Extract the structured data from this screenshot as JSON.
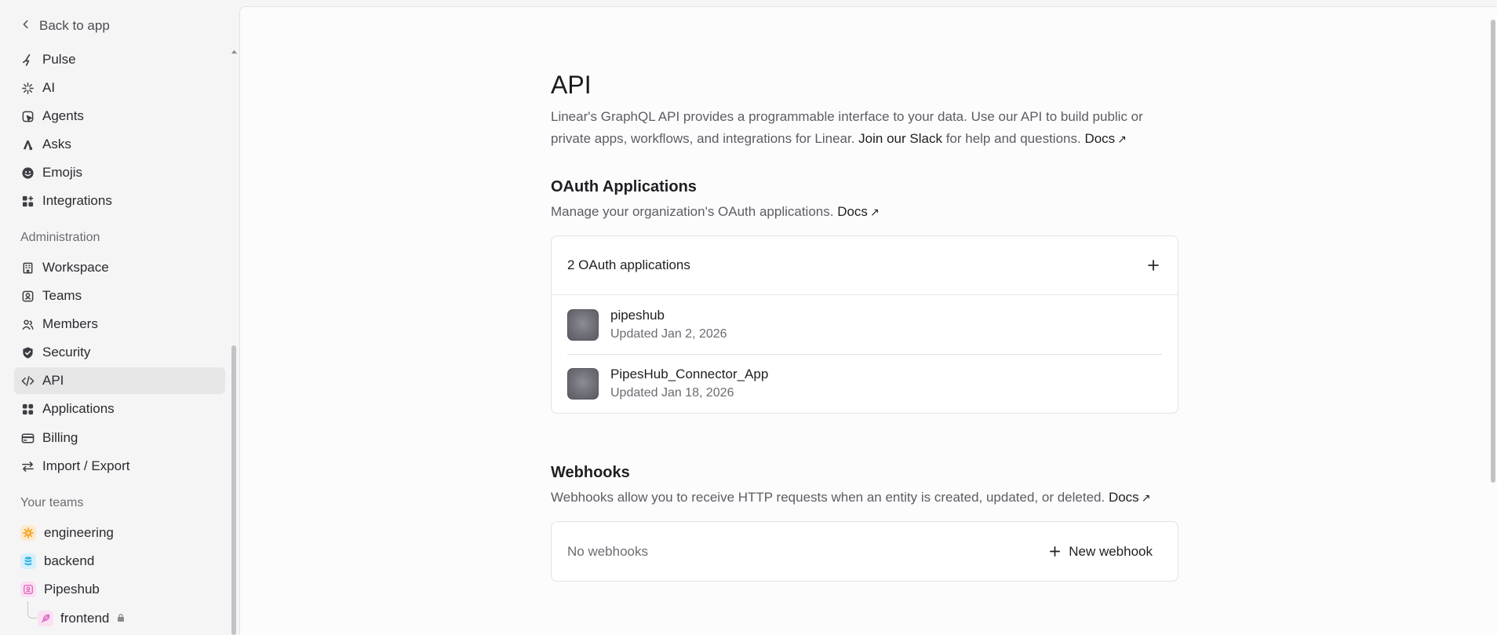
{
  "sidebar": {
    "back_label": "Back to app",
    "items_top": [
      {
        "label": "Pulse",
        "icon": "pulse-icon"
      },
      {
        "label": "AI",
        "icon": "sparkle-icon"
      },
      {
        "label": "Agents",
        "icon": "agents-icon"
      },
      {
        "label": "Asks",
        "icon": "asks-icon"
      },
      {
        "label": "Emojis",
        "icon": "emoji-icon"
      },
      {
        "label": "Integrations",
        "icon": "integrations-icon"
      }
    ],
    "admin_label": "Administration",
    "items_admin": [
      {
        "label": "Workspace",
        "icon": "building-icon"
      },
      {
        "label": "Teams",
        "icon": "teams-icon"
      },
      {
        "label": "Members",
        "icon": "members-icon"
      },
      {
        "label": "Security",
        "icon": "shield-icon"
      },
      {
        "label": "API",
        "icon": "code-icon",
        "active": true
      },
      {
        "label": "Applications",
        "icon": "applications-icon"
      },
      {
        "label": "Billing",
        "icon": "card-icon"
      },
      {
        "label": "Import / Export",
        "icon": "arrows-icon"
      }
    ],
    "teams_label": "Your teams",
    "teams": [
      {
        "label": "engineering",
        "icon": "gear-icon",
        "color": "#f5a524"
      },
      {
        "label": "backend",
        "icon": "database-icon",
        "color": "#2fb3e6"
      },
      {
        "label": "Pipeshub",
        "icon": "team-icon",
        "color": "#e05fbf"
      }
    ],
    "sub_team": {
      "label": "frontend",
      "icon": "feather-icon",
      "color": "#e05fbf"
    }
  },
  "main": {
    "title": "API",
    "desc_part1": "Linear's GraphQL API provides a programmable interface to your data. Use our API to build public or private apps, workflows, and integrations for Linear.",
    "desc_link_slack": "Join our Slack",
    "desc_part2": "for help and questions.",
    "docs_label": "Docs",
    "oauth": {
      "title": "OAuth Applications",
      "desc": "Manage your organization's OAuth applications.",
      "docs_label": "Docs",
      "count_label": "2 OAuth applications",
      "apps": [
        {
          "name": "pipeshub",
          "updated": "Updated Jan 2, 2026"
        },
        {
          "name": "PipesHub_Connector_App",
          "updated": "Updated Jan 18, 2026"
        }
      ]
    },
    "webhooks": {
      "title": "Webhooks",
      "desc": "Webhooks allow you to receive HTTP requests when an entity is created, updated, or deleted.",
      "docs_label": "Docs",
      "empty_label": "No webhooks",
      "new_label": "New webhook"
    }
  }
}
